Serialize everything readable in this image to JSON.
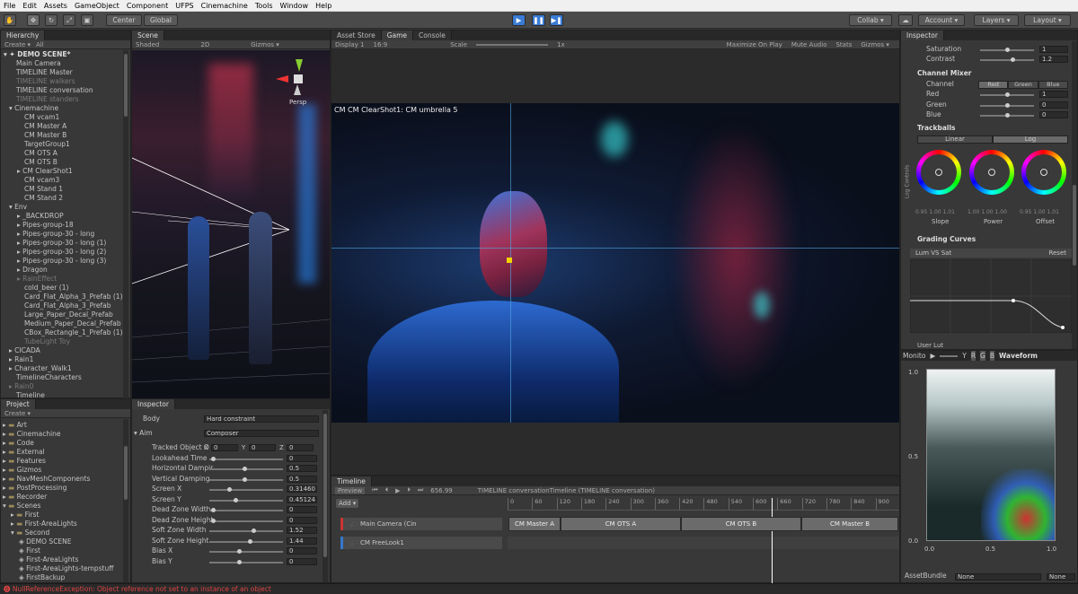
{
  "menu": [
    "File",
    "Edit",
    "Assets",
    "GameObject",
    "Component",
    "UFPS",
    "Cinemachine",
    "Tools",
    "Window",
    "Help"
  ],
  "toolbar": {
    "center": "Center",
    "global": "Global",
    "collab": "Collab ▾",
    "account": "Account ▾",
    "layers": "Layers ▾",
    "layout": "Layout ▾"
  },
  "hierarchy": {
    "tab": "Hierarchy",
    "create": "Create ▾",
    "search": "All",
    "scene": "DEMO SCENE*",
    "items": [
      {
        "t": "Main Camera",
        "i": 1,
        "d": false
      },
      {
        "t": "TIMELINE Master",
        "i": 1,
        "d": false
      },
      {
        "t": "TIMELINE walkers",
        "i": 1,
        "d": true
      },
      {
        "t": "TIMELINE conversation",
        "i": 1,
        "d": false
      },
      {
        "t": "TIMELINE standers",
        "i": 1,
        "d": true
      },
      {
        "t": "Cinemachine",
        "i": 1,
        "d": false,
        "a": "▾"
      },
      {
        "t": "CM vcam1",
        "i": 2,
        "d": false
      },
      {
        "t": "CM Master A",
        "i": 2,
        "d": false
      },
      {
        "t": "CM Master B",
        "i": 2,
        "d": false
      },
      {
        "t": "TargetGroup1",
        "i": 2,
        "d": false
      },
      {
        "t": "CM OTS A",
        "i": 2,
        "d": false
      },
      {
        "t": "CM OTS B",
        "i": 2,
        "d": false
      },
      {
        "t": "CM ClearShot1",
        "i": 2,
        "d": false,
        "a": "▸"
      },
      {
        "t": "CM vcam3",
        "i": 2,
        "d": false
      },
      {
        "t": "CM Stand 1",
        "i": 2,
        "d": false
      },
      {
        "t": "CM Stand 2",
        "i": 2,
        "d": false
      },
      {
        "t": "Env",
        "i": 1,
        "d": false,
        "a": "▾"
      },
      {
        "t": "_BACKDROP",
        "i": 2,
        "d": false,
        "a": "▸"
      },
      {
        "t": "Pipes-group-18",
        "i": 2,
        "d": false,
        "a": "▸"
      },
      {
        "t": "Pipes-group-30 - long",
        "i": 2,
        "d": false,
        "a": "▸"
      },
      {
        "t": "Pipes-group-30 - long (1)",
        "i": 2,
        "d": false,
        "a": "▸"
      },
      {
        "t": "Pipes-group-30 - long (2)",
        "i": 2,
        "d": false,
        "a": "▸"
      },
      {
        "t": "Pipes-group-30 - long (3)",
        "i": 2,
        "d": false,
        "a": "▸"
      },
      {
        "t": "Dragon",
        "i": 2,
        "d": false,
        "a": "▸"
      },
      {
        "t": "RainEffect",
        "i": 2,
        "d": true,
        "a": "▸"
      },
      {
        "t": "cold_beer (1)",
        "i": 2,
        "d": false
      },
      {
        "t": "Card_Flat_Alpha_3_Prefab (1)",
        "i": 2,
        "d": false
      },
      {
        "t": "Card_Flat_Alpha_3_Prefab",
        "i": 2,
        "d": false
      },
      {
        "t": "Large_Paper_Decal_Prefab",
        "i": 2,
        "d": false
      },
      {
        "t": "Medium_Paper_Decal_Prefab",
        "i": 2,
        "d": false
      },
      {
        "t": "CBox_Rectangle_1_Prefab (1)",
        "i": 2,
        "d": false
      },
      {
        "t": "TubeLight Toy",
        "i": 2,
        "d": true
      },
      {
        "t": "CICADA",
        "i": 1,
        "d": false,
        "a": "▸"
      },
      {
        "t": "Rain1",
        "i": 1,
        "d": false,
        "a": "▸"
      },
      {
        "t": "Character_Walk1",
        "i": 1,
        "d": false,
        "a": "▸"
      },
      {
        "t": "TimelineCharacters",
        "i": 1,
        "d": false
      },
      {
        "t": "Rain0",
        "i": 1,
        "d": true,
        "a": "▸"
      },
      {
        "t": "Timeline",
        "i": 1,
        "d": false
      }
    ]
  },
  "project": {
    "tab": "Project",
    "create": "Create ▾",
    "items": [
      {
        "t": "Art",
        "i": 0,
        "a": "▸"
      },
      {
        "t": "Cinemachine",
        "i": 0,
        "a": "▸"
      },
      {
        "t": "Code",
        "i": 0,
        "a": "▸"
      },
      {
        "t": "External",
        "i": 0,
        "a": "▸"
      },
      {
        "t": "Features",
        "i": 0,
        "a": "▸"
      },
      {
        "t": "Gizmos",
        "i": 0,
        "a": "▸"
      },
      {
        "t": "NavMeshComponents",
        "i": 0,
        "a": "▸"
      },
      {
        "t": "PostProcessing",
        "i": 0,
        "a": "▸"
      },
      {
        "t": "Recorder",
        "i": 0,
        "a": "▸"
      },
      {
        "t": "Scenes",
        "i": 0,
        "a": "▾"
      },
      {
        "t": "First",
        "i": 1,
        "a": "▸"
      },
      {
        "t": "First-AreaLights",
        "i": 1,
        "a": "▸"
      },
      {
        "t": "Second",
        "i": 1,
        "a": "▾"
      },
      {
        "t": "DEMO SCENE",
        "i": 2
      },
      {
        "t": "First",
        "i": 2
      },
      {
        "t": "First-AreaLights",
        "i": 2
      },
      {
        "t": "First-AreaLights-tempstuff",
        "i": 2
      },
      {
        "t": "FirstBackup",
        "i": 2
      }
    ]
  },
  "scene": {
    "tab": "Scene",
    "shading": "Shaded",
    "mode": "2D",
    "gizmos": "Gizmos ▾",
    "search": "All",
    "persp": "Persp"
  },
  "inspector_mid": {
    "tab": "Inspector",
    "body_label": "Body",
    "body_value": "Hard constraint",
    "aim_label": "Aim",
    "aim_value": "Composer",
    "rows": [
      {
        "l": "Tracked Object O",
        "x": "0",
        "y": "0",
        "z": "0"
      },
      {
        "l": "Lookahead Time",
        "v": "0"
      },
      {
        "l": "Horizontal Dampir",
        "v": "0.5"
      },
      {
        "l": "Vertical Damping",
        "v": "0.5"
      },
      {
        "l": "Screen X",
        "v": "0.31460"
      },
      {
        "l": "Screen Y",
        "v": "0.45124"
      },
      {
        "l": "Dead Zone Width",
        "v": "0"
      },
      {
        "l": "Dead Zone Height",
        "v": "0"
      },
      {
        "l": "Soft Zone Width",
        "v": "1.52"
      },
      {
        "l": "Soft Zone Height",
        "v": "1.44"
      },
      {
        "l": "Bias X",
        "v": "0"
      },
      {
        "l": "Bias Y",
        "v": "0"
      }
    ],
    "slider_frac": [
      0.02,
      0.48,
      0.48,
      0.25,
      0.35,
      0.02,
      0.02,
      0.6,
      0.55,
      0.4,
      0.4
    ]
  },
  "game": {
    "tabs": [
      "Asset Store",
      "Game",
      "Console"
    ],
    "display": "Display 1",
    "aspect": "16:9",
    "scale_label": "Scale",
    "scale_val": "1x",
    "buttons": [
      "Maximize On Play",
      "Mute Audio",
      "Stats",
      "Gizmos ▾"
    ],
    "overlay": "CM CM ClearShot1: CM umbrella 5"
  },
  "timeline": {
    "tab": "Timeline",
    "preview": "Preview",
    "time": "656.99",
    "title": "TIMELINE conversationTimeline (TIMELINE conversation)",
    "add": "Add ▾",
    "ticks": [
      "0",
      "60",
      "120",
      "180",
      "240",
      "300",
      "360",
      "420",
      "480",
      "540",
      "600",
      "660",
      "720",
      "780",
      "840",
      "900"
    ],
    "tracks": [
      "Main Camera (Cin",
      "CM FreeLook1"
    ],
    "clips": [
      "CM Master A",
      "CM OTS A",
      "CM OTS B",
      "CM Master B"
    ]
  },
  "inspector_right": {
    "tab": "Inspector",
    "saturation_label": "Saturation",
    "saturation": "1",
    "contrast_label": "Contrast",
    "contrast": "1.2",
    "channel_mixer": "Channel Mixer",
    "channel_label": "Channel",
    "channels": [
      "Red",
      "Green",
      "Blue"
    ],
    "mixer": [
      {
        "l": "Red",
        "v": "1"
      },
      {
        "l": "Green",
        "v": "0"
      },
      {
        "l": "Blue",
        "v": "0"
      }
    ],
    "trackballs": "Trackballs",
    "tb_modes": [
      "Linear",
      "Log"
    ],
    "tb_side": "Log Controls",
    "wheel_vals": [
      "0.95 1.00 1.01",
      "1.00 1.00 1.00",
      "0.95 1.00 1.01"
    ],
    "wheels": [
      "Slope",
      "Power",
      "Offset"
    ],
    "grading": "Grading Curves",
    "curve_name": "Lum VS Sat",
    "reset": "Reset",
    "user_lut": "User Lut"
  },
  "monitor": {
    "tab": "Monito",
    "mode": "Waveform",
    "channels": [
      "Y",
      "R",
      "G",
      "B"
    ],
    "y_ticks": [
      "1.0",
      "0.5",
      "0.0"
    ],
    "x_ticks": [
      "0.0",
      "0.5",
      "1.0"
    ],
    "assetbundle": "AssetBundle",
    "ab_val": "None",
    "ab_val2": "None"
  },
  "status": "NullReferenceException: Object reference not set to an instance of an object"
}
